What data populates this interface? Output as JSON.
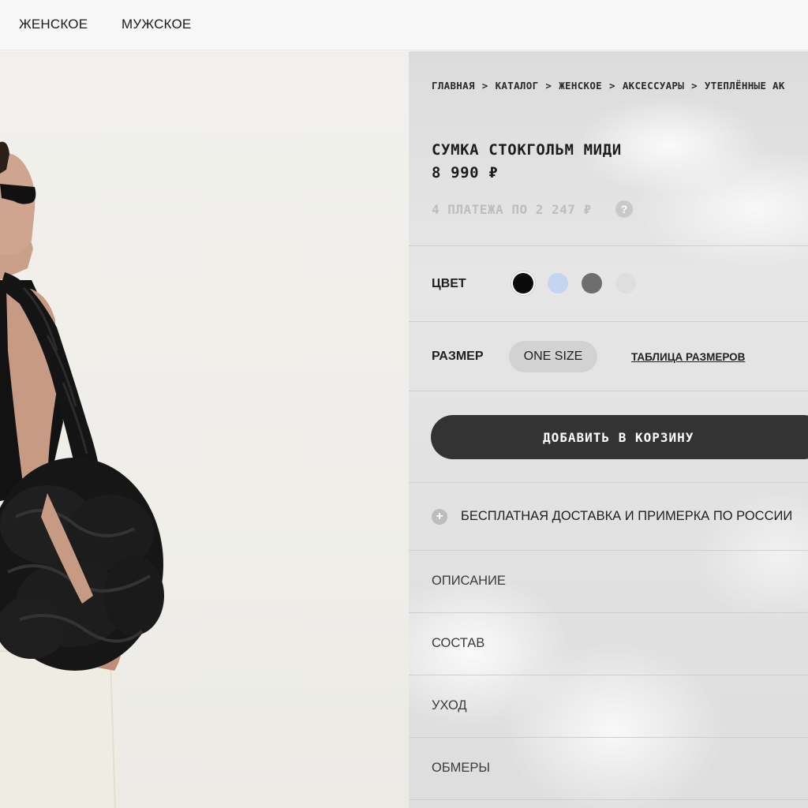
{
  "nav": {
    "items": [
      "ЖЕНСКОЕ",
      "МУЖСКОЕ"
    ]
  },
  "product": {
    "breadcrumb": [
      "ГЛАВНАЯ",
      "КАТАЛОГ",
      "ЖЕНСКОЕ",
      "АКСЕССУАРЫ",
      "УТЕПЛЁННЫЕ АК"
    ],
    "breadcrumb_separator": ">",
    "title": "СУМКА СТОКГОЛЬМ МИДИ",
    "price": "8 990 ₽",
    "installments": "4 ПЛАТЕЖА ПО 2 247 ₽",
    "help_icon": "?",
    "color_label": "ЦВЕТ",
    "colors": [
      "#0a0a0a",
      "#c5d4f0",
      "#6e6e6e",
      "#dedede"
    ],
    "selected_color": 0,
    "size_label": "РАЗМЕР",
    "size_value": "ONE SIZE",
    "size_table_link": "ТАБЛИЦА РАЗМЕРОВ",
    "add_to_cart": "ДОБАВИТЬ В КОРЗИНУ",
    "delivery_icon": "+",
    "delivery": "БЕСПЛАТНАЯ ДОСТАВКА И ПРИМЕРКА ПО РОССИИ",
    "sections": [
      "ОПИСАНИЕ",
      "СОСТАВ",
      "УХОД",
      "ОБМЕРЫ"
    ]
  }
}
